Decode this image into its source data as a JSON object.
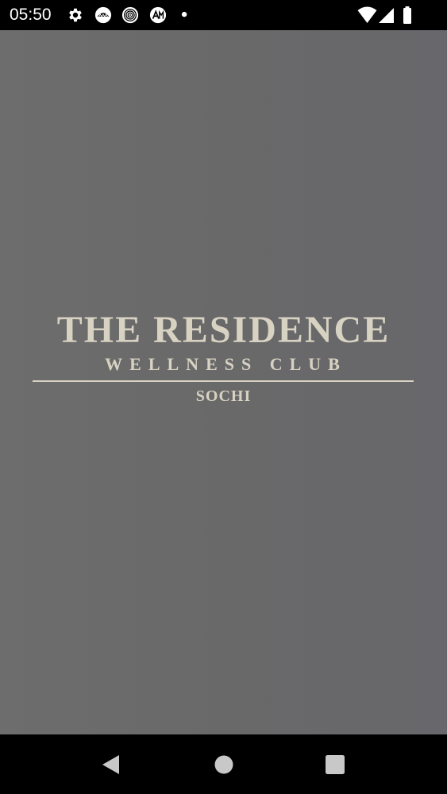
{
  "status_bar": {
    "time": "05:50",
    "left_icons": [
      "settings-icon",
      "umbrella-app-icon",
      "spiral-app-icon",
      "ai-app-icon",
      "notification-dot-icon"
    ],
    "right_icons": [
      "wifi-icon",
      "cellular-signal-icon",
      "battery-icon"
    ]
  },
  "splash": {
    "background_color": "#6a6a6a",
    "logo_color": "#d8d2c3",
    "logo": {
      "title": "THE RESIDENCE",
      "subtitle": "WELLNESS CLUB",
      "city": "SOCHI"
    }
  },
  "nav_bar": {
    "buttons": [
      "back-icon",
      "home-icon",
      "recents-icon"
    ]
  }
}
